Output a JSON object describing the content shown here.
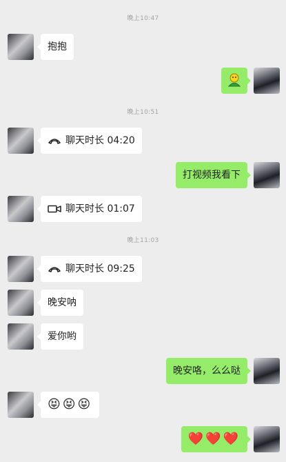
{
  "timestamps": [
    "晚上10:47",
    "晚上10:51",
    "晚上11:03"
  ],
  "messages": {
    "m1": {
      "text": "抱抱"
    },
    "m2": {
      "emoji": "🙂"
    },
    "m3": {
      "text": "聊天时长 04:20",
      "icon": "voice-call-icon"
    },
    "m4": {
      "text": "打视频我看下"
    },
    "m5": {
      "text": "聊天时长 01:07",
      "icon": "video-call-icon"
    },
    "m6": {
      "text": "聊天时长 09:25",
      "icon": "voice-call-icon"
    },
    "m7": {
      "text": "晚安呐"
    },
    "m8": {
      "text": "爱你哟"
    },
    "m9": {
      "text": "晚安咯，么么哒"
    },
    "m10": {
      "emojis": [
        "😝",
        "😝",
        "😝"
      ]
    },
    "m11": {
      "emojis": [
        "❤️",
        "❤️",
        "❤️"
      ]
    }
  },
  "colors": {
    "background": "#ededed",
    "incoming": "#ffffff",
    "outgoing": "#95ec69"
  }
}
